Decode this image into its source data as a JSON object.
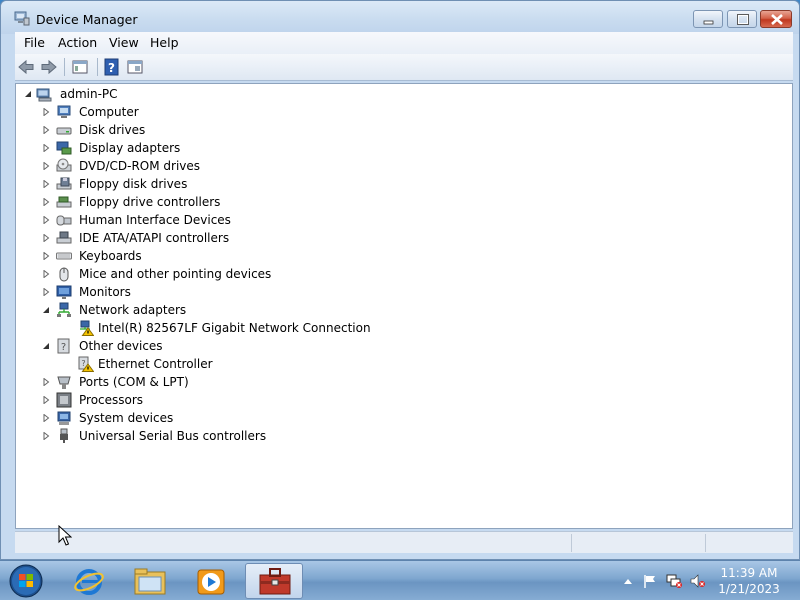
{
  "window": {
    "title": "Device Manager",
    "app_icon": "device-manager-icon"
  },
  "menu": [
    "File",
    "Action",
    "View",
    "Help"
  ],
  "toolbar": {
    "buttons": [
      "back-icon",
      "forward-icon",
      "show-hide-tree-icon",
      "help-icon",
      "properties-icon"
    ]
  },
  "tree": {
    "root": "admin-PC",
    "categories": [
      {
        "label": "Computer",
        "icon": "computer-icon",
        "expanded": false
      },
      {
        "label": "Disk drives",
        "icon": "disk-drive-icon",
        "expanded": false
      },
      {
        "label": "Display adapters",
        "icon": "display-adapter-icon",
        "expanded": false
      },
      {
        "label": "DVD/CD-ROM drives",
        "icon": "dvd-drive-icon",
        "expanded": false
      },
      {
        "label": "Floppy disk drives",
        "icon": "floppy-drive-icon",
        "expanded": false
      },
      {
        "label": "Floppy drive controllers",
        "icon": "floppy-controller-icon",
        "expanded": false
      },
      {
        "label": "Human Interface Devices",
        "icon": "hid-icon",
        "expanded": false
      },
      {
        "label": "IDE ATA/ATAPI controllers",
        "icon": "ide-controller-icon",
        "expanded": false
      },
      {
        "label": "Keyboards",
        "icon": "keyboard-icon",
        "expanded": false
      },
      {
        "label": "Mice and other pointing devices",
        "icon": "mouse-icon",
        "expanded": false
      },
      {
        "label": "Monitors",
        "icon": "monitor-icon",
        "expanded": false
      },
      {
        "label": "Network adapters",
        "icon": "network-adapter-icon",
        "expanded": true,
        "children": [
          {
            "label": "Intel(R) 82567LF Gigabit Network Connection",
            "icon": "network-warning-icon"
          }
        ]
      },
      {
        "label": "Other devices",
        "icon": "unknown-device-icon",
        "expanded": true,
        "children": [
          {
            "label": "Ethernet Controller",
            "icon": "unknown-warning-icon"
          }
        ]
      },
      {
        "label": "Ports (COM & LPT)",
        "icon": "port-icon",
        "expanded": false
      },
      {
        "label": "Processors",
        "icon": "processor-icon",
        "expanded": false
      },
      {
        "label": "System devices",
        "icon": "system-device-icon",
        "expanded": false
      },
      {
        "label": "Universal Serial Bus controllers",
        "icon": "usb-icon",
        "expanded": false
      }
    ]
  },
  "taskbar": {
    "pinned": [
      "internet-explorer-icon",
      "windows-explorer-icon",
      "media-player-icon",
      "device-manager-task-icon"
    ],
    "tray": [
      "show-hidden-icons-icon",
      "action-center-flag-icon",
      "network-icon",
      "volume-muted-icon"
    ],
    "clock_time": "11:39 AM",
    "clock_date": "1/21/2023"
  },
  "colors": {
    "title_bg": "#c8dbef",
    "close_red": "#c0381f",
    "taskbar": "#7ea6cf",
    "warning_yellow": "#f5c400"
  }
}
